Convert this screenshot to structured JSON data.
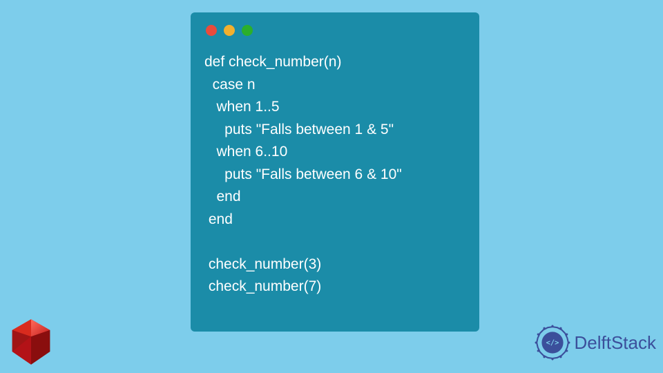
{
  "code": {
    "lines": [
      "def check_number(n)",
      "  case n",
      "   when 1..5",
      "     puts \"Falls between 1 & 5\"",
      "   when 6..10",
      "     puts \"Falls between 6 & 10\"",
      "   end",
      " end",
      "",
      " check_number(3)",
      " check_number(7)"
    ]
  },
  "brand": {
    "name": "DelftStack"
  },
  "icons": {
    "ruby": "ruby-gem-icon",
    "delftstack": "delftstack-gear-icon"
  },
  "colors": {
    "background": "#7DCDEB",
    "window": "#1B8CA8",
    "code_text": "#FFFFFF",
    "brand_text": "#3B4F9B"
  }
}
